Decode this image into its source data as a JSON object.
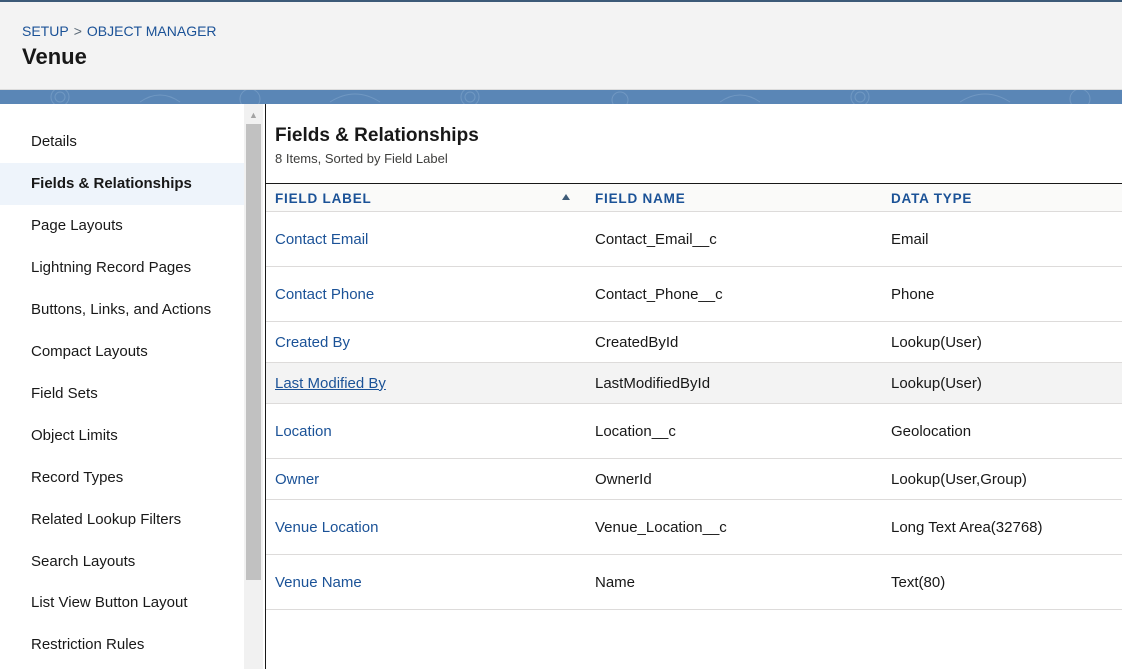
{
  "breadcrumb": {
    "setup": "SETUP",
    "separator": ">",
    "object_manager": "OBJECT MANAGER"
  },
  "header": {
    "title": "Venue"
  },
  "sidebar": {
    "items": [
      {
        "label": "Details"
      },
      {
        "label": "Fields & Relationships",
        "active": true
      },
      {
        "label": "Page Layouts"
      },
      {
        "label": "Lightning Record Pages"
      },
      {
        "label": "Buttons, Links, and Actions"
      },
      {
        "label": "Compact Layouts"
      },
      {
        "label": "Field Sets"
      },
      {
        "label": "Object Limits"
      },
      {
        "label": "Record Types"
      },
      {
        "label": "Related Lookup Filters"
      },
      {
        "label": "Search Layouts"
      },
      {
        "label": "List View Button Layout"
      },
      {
        "label": "Restriction Rules"
      }
    ]
  },
  "main": {
    "title": "Fields & Relationships",
    "subtitle": "8 Items, Sorted by Field Label",
    "columns": [
      "FIELD LABEL",
      "FIELD NAME",
      "DATA TYPE"
    ],
    "sort": {
      "column": "FIELD LABEL",
      "direction": "ascending",
      "icon": "sort-up-icon"
    },
    "rows": [
      {
        "label": "Contact Email",
        "name": "Contact_Email__c",
        "type": "Email"
      },
      {
        "label": "Contact Phone",
        "name": "Contact_Phone__c",
        "type": "Phone"
      },
      {
        "label": "Created By",
        "name": "CreatedById",
        "type": "Lookup(User)"
      },
      {
        "label": "Last Modified By",
        "name": "LastModifiedById",
        "type": "Lookup(User)",
        "hovered": true
      },
      {
        "label": "Location",
        "name": "Location__c",
        "type": "Geolocation"
      },
      {
        "label": "Owner",
        "name": "OwnerId",
        "type": "Lookup(User,Group)"
      },
      {
        "label": "Venue Location",
        "name": "Venue_Location__c",
        "type": "Long Text Area(32768)"
      },
      {
        "label": "Venue Name",
        "name": "Name",
        "type": "Text(80)"
      }
    ]
  },
  "colors": {
    "link": "#1b5297",
    "banner": "#5a86b6",
    "active_item_bg": "#eef4fb",
    "header_bg": "#f3f3f3"
  }
}
